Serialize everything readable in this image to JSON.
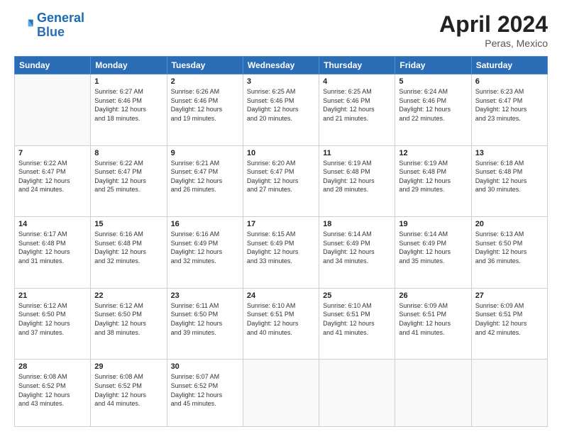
{
  "header": {
    "logo_line1": "General",
    "logo_line2": "Blue",
    "month": "April 2024",
    "location": "Peras, Mexico"
  },
  "days_of_week": [
    "Sunday",
    "Monday",
    "Tuesday",
    "Wednesday",
    "Thursday",
    "Friday",
    "Saturday"
  ],
  "weeks": [
    [
      {
        "day": "",
        "info": ""
      },
      {
        "day": "1",
        "info": "Sunrise: 6:27 AM\nSunset: 6:46 PM\nDaylight: 12 hours\nand 18 minutes."
      },
      {
        "day": "2",
        "info": "Sunrise: 6:26 AM\nSunset: 6:46 PM\nDaylight: 12 hours\nand 19 minutes."
      },
      {
        "day": "3",
        "info": "Sunrise: 6:25 AM\nSunset: 6:46 PM\nDaylight: 12 hours\nand 20 minutes."
      },
      {
        "day": "4",
        "info": "Sunrise: 6:25 AM\nSunset: 6:46 PM\nDaylight: 12 hours\nand 21 minutes."
      },
      {
        "day": "5",
        "info": "Sunrise: 6:24 AM\nSunset: 6:46 PM\nDaylight: 12 hours\nand 22 minutes."
      },
      {
        "day": "6",
        "info": "Sunrise: 6:23 AM\nSunset: 6:47 PM\nDaylight: 12 hours\nand 23 minutes."
      }
    ],
    [
      {
        "day": "7",
        "info": "Sunrise: 6:22 AM\nSunset: 6:47 PM\nDaylight: 12 hours\nand 24 minutes."
      },
      {
        "day": "8",
        "info": "Sunrise: 6:22 AM\nSunset: 6:47 PM\nDaylight: 12 hours\nand 25 minutes."
      },
      {
        "day": "9",
        "info": "Sunrise: 6:21 AM\nSunset: 6:47 PM\nDaylight: 12 hours\nand 26 minutes."
      },
      {
        "day": "10",
        "info": "Sunrise: 6:20 AM\nSunset: 6:47 PM\nDaylight: 12 hours\nand 27 minutes."
      },
      {
        "day": "11",
        "info": "Sunrise: 6:19 AM\nSunset: 6:48 PM\nDaylight: 12 hours\nand 28 minutes."
      },
      {
        "day": "12",
        "info": "Sunrise: 6:19 AM\nSunset: 6:48 PM\nDaylight: 12 hours\nand 29 minutes."
      },
      {
        "day": "13",
        "info": "Sunrise: 6:18 AM\nSunset: 6:48 PM\nDaylight: 12 hours\nand 30 minutes."
      }
    ],
    [
      {
        "day": "14",
        "info": "Sunrise: 6:17 AM\nSunset: 6:48 PM\nDaylight: 12 hours\nand 31 minutes."
      },
      {
        "day": "15",
        "info": "Sunrise: 6:16 AM\nSunset: 6:48 PM\nDaylight: 12 hours\nand 32 minutes."
      },
      {
        "day": "16",
        "info": "Sunrise: 6:16 AM\nSunset: 6:49 PM\nDaylight: 12 hours\nand 32 minutes."
      },
      {
        "day": "17",
        "info": "Sunrise: 6:15 AM\nSunset: 6:49 PM\nDaylight: 12 hours\nand 33 minutes."
      },
      {
        "day": "18",
        "info": "Sunrise: 6:14 AM\nSunset: 6:49 PM\nDaylight: 12 hours\nand 34 minutes."
      },
      {
        "day": "19",
        "info": "Sunrise: 6:14 AM\nSunset: 6:49 PM\nDaylight: 12 hours\nand 35 minutes."
      },
      {
        "day": "20",
        "info": "Sunrise: 6:13 AM\nSunset: 6:50 PM\nDaylight: 12 hours\nand 36 minutes."
      }
    ],
    [
      {
        "day": "21",
        "info": "Sunrise: 6:12 AM\nSunset: 6:50 PM\nDaylight: 12 hours\nand 37 minutes."
      },
      {
        "day": "22",
        "info": "Sunrise: 6:12 AM\nSunset: 6:50 PM\nDaylight: 12 hours\nand 38 minutes."
      },
      {
        "day": "23",
        "info": "Sunrise: 6:11 AM\nSunset: 6:50 PM\nDaylight: 12 hours\nand 39 minutes."
      },
      {
        "day": "24",
        "info": "Sunrise: 6:10 AM\nSunset: 6:51 PM\nDaylight: 12 hours\nand 40 minutes."
      },
      {
        "day": "25",
        "info": "Sunrise: 6:10 AM\nSunset: 6:51 PM\nDaylight: 12 hours\nand 41 minutes."
      },
      {
        "day": "26",
        "info": "Sunrise: 6:09 AM\nSunset: 6:51 PM\nDaylight: 12 hours\nand 41 minutes."
      },
      {
        "day": "27",
        "info": "Sunrise: 6:09 AM\nSunset: 6:51 PM\nDaylight: 12 hours\nand 42 minutes."
      }
    ],
    [
      {
        "day": "28",
        "info": "Sunrise: 6:08 AM\nSunset: 6:52 PM\nDaylight: 12 hours\nand 43 minutes."
      },
      {
        "day": "29",
        "info": "Sunrise: 6:08 AM\nSunset: 6:52 PM\nDaylight: 12 hours\nand 44 minutes."
      },
      {
        "day": "30",
        "info": "Sunrise: 6:07 AM\nSunset: 6:52 PM\nDaylight: 12 hours\nand 45 minutes."
      },
      {
        "day": "",
        "info": ""
      },
      {
        "day": "",
        "info": ""
      },
      {
        "day": "",
        "info": ""
      },
      {
        "day": "",
        "info": ""
      }
    ]
  ]
}
